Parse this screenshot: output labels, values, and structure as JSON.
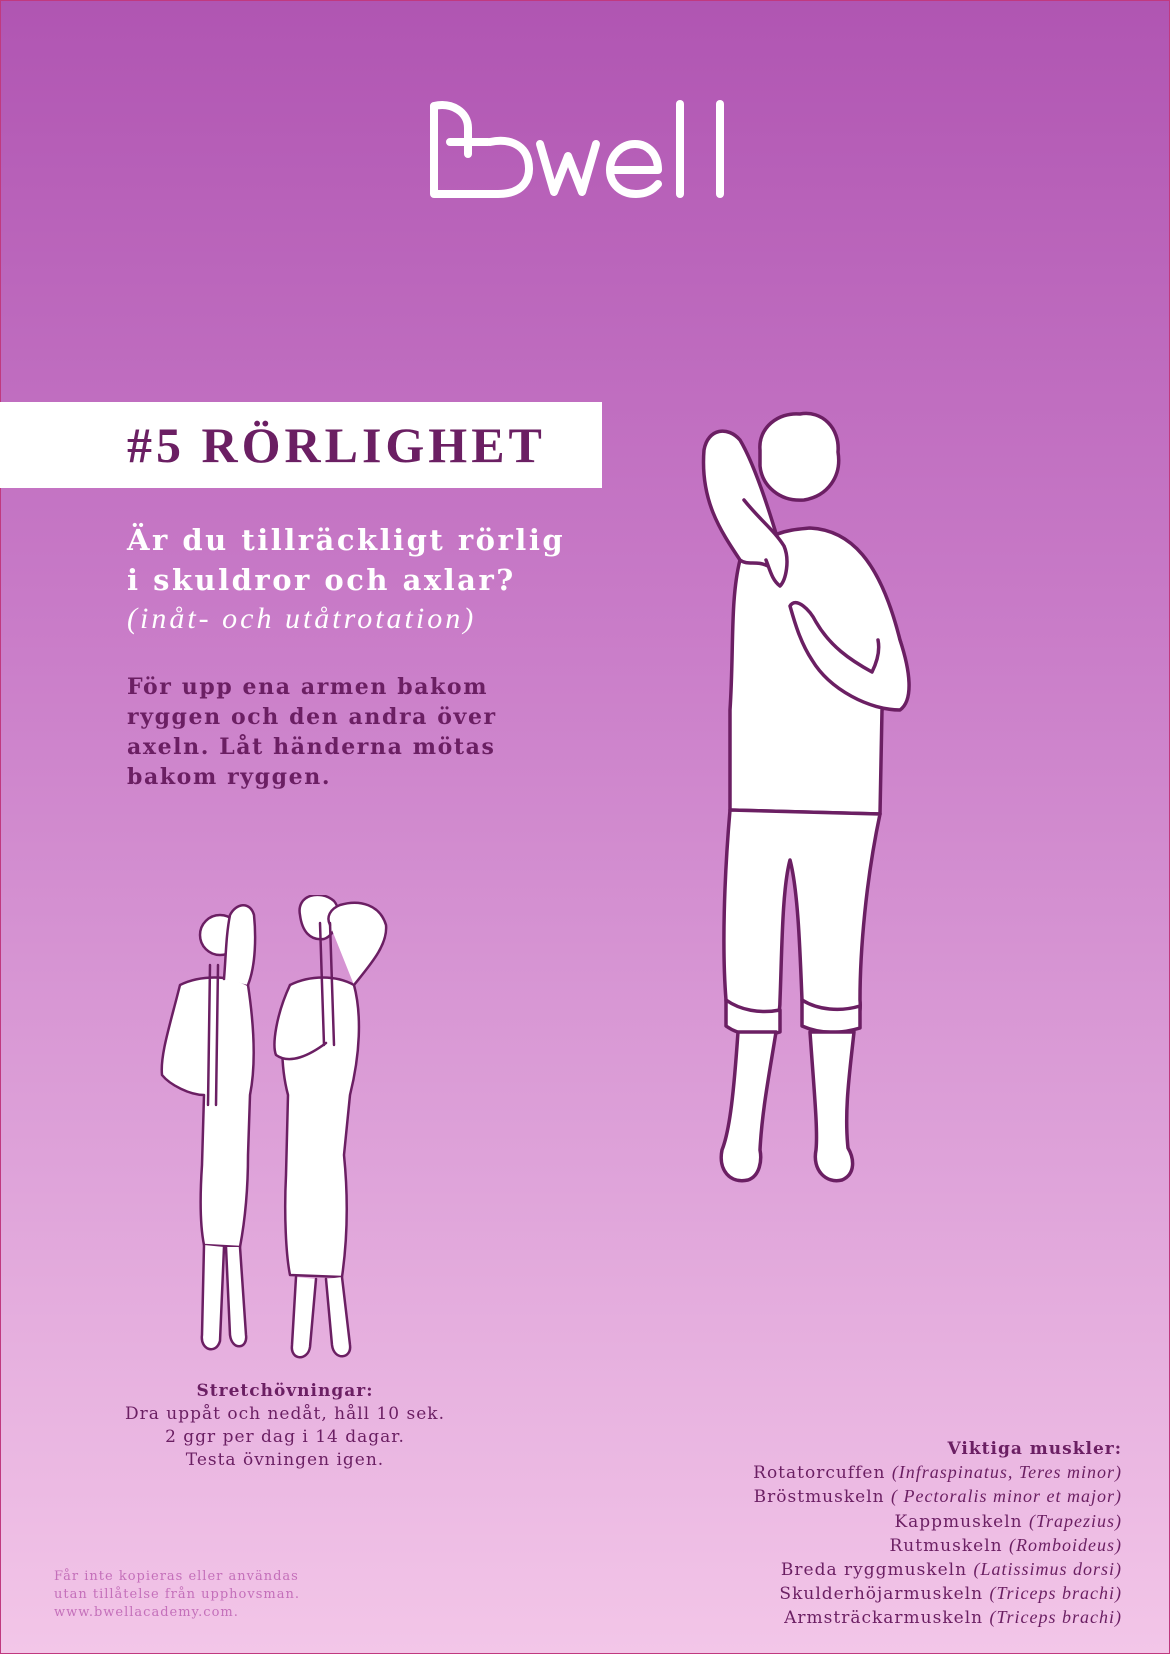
{
  "brand": {
    "logo_text": "Bwell",
    "primary": "#6b1f63",
    "white": "#ffffff"
  },
  "title": "#5 RÖRLIGHET",
  "question": {
    "line1": "Är du tillräckligt rörlig",
    "line2": "i skuldror och axlar?"
  },
  "subtitle": "(inåt- och utåtrotation)",
  "instruction": {
    "line1": "För upp ena armen bakom",
    "line2": "ryggen och den andra över",
    "line3": "axeln. Låt händerna mötas",
    "line4": "bakom ryggen."
  },
  "stretch": {
    "heading": "Stretchövningar:",
    "line1": "Dra uppåt och nedåt, håll 10 sek.",
    "line2": "2 ggr per dag i 14 dagar.",
    "line3": "Testa övningen igen."
  },
  "muscles": {
    "heading": "Viktiga muskler:",
    "items": [
      {
        "name": "Rotatorcuffen ",
        "latin": "(Infraspinatus, Teres minor)"
      },
      {
        "name": "Bröstmuskeln ",
        "latin": "( Pectoralis minor et major)"
      },
      {
        "name": "Kappmuskeln ",
        "latin": "(Trapezius)"
      },
      {
        "name": "Rutmuskeln ",
        "latin": "(Romboideus)"
      },
      {
        "name": "Breda ryggmuskeln ",
        "latin": "(Latissimus dorsi)"
      },
      {
        "name": "Skulderhöjarmuskeln ",
        "latin": "(Triceps brachi)"
      },
      {
        "name": "Armsträckarmuskeln ",
        "latin": "(Triceps brachi)"
      }
    ]
  },
  "copyright": {
    "line1": "Får inte kopieras eller användas",
    "line2": "utan tillåtelse från upphovsman.",
    "line3": "www.bwellacademy.com."
  },
  "icons": {
    "logo": "bwell-logo-icon",
    "main_figure": "person-shoulder-stretch-icon",
    "small_figures": "people-towel-stretch-icon"
  }
}
